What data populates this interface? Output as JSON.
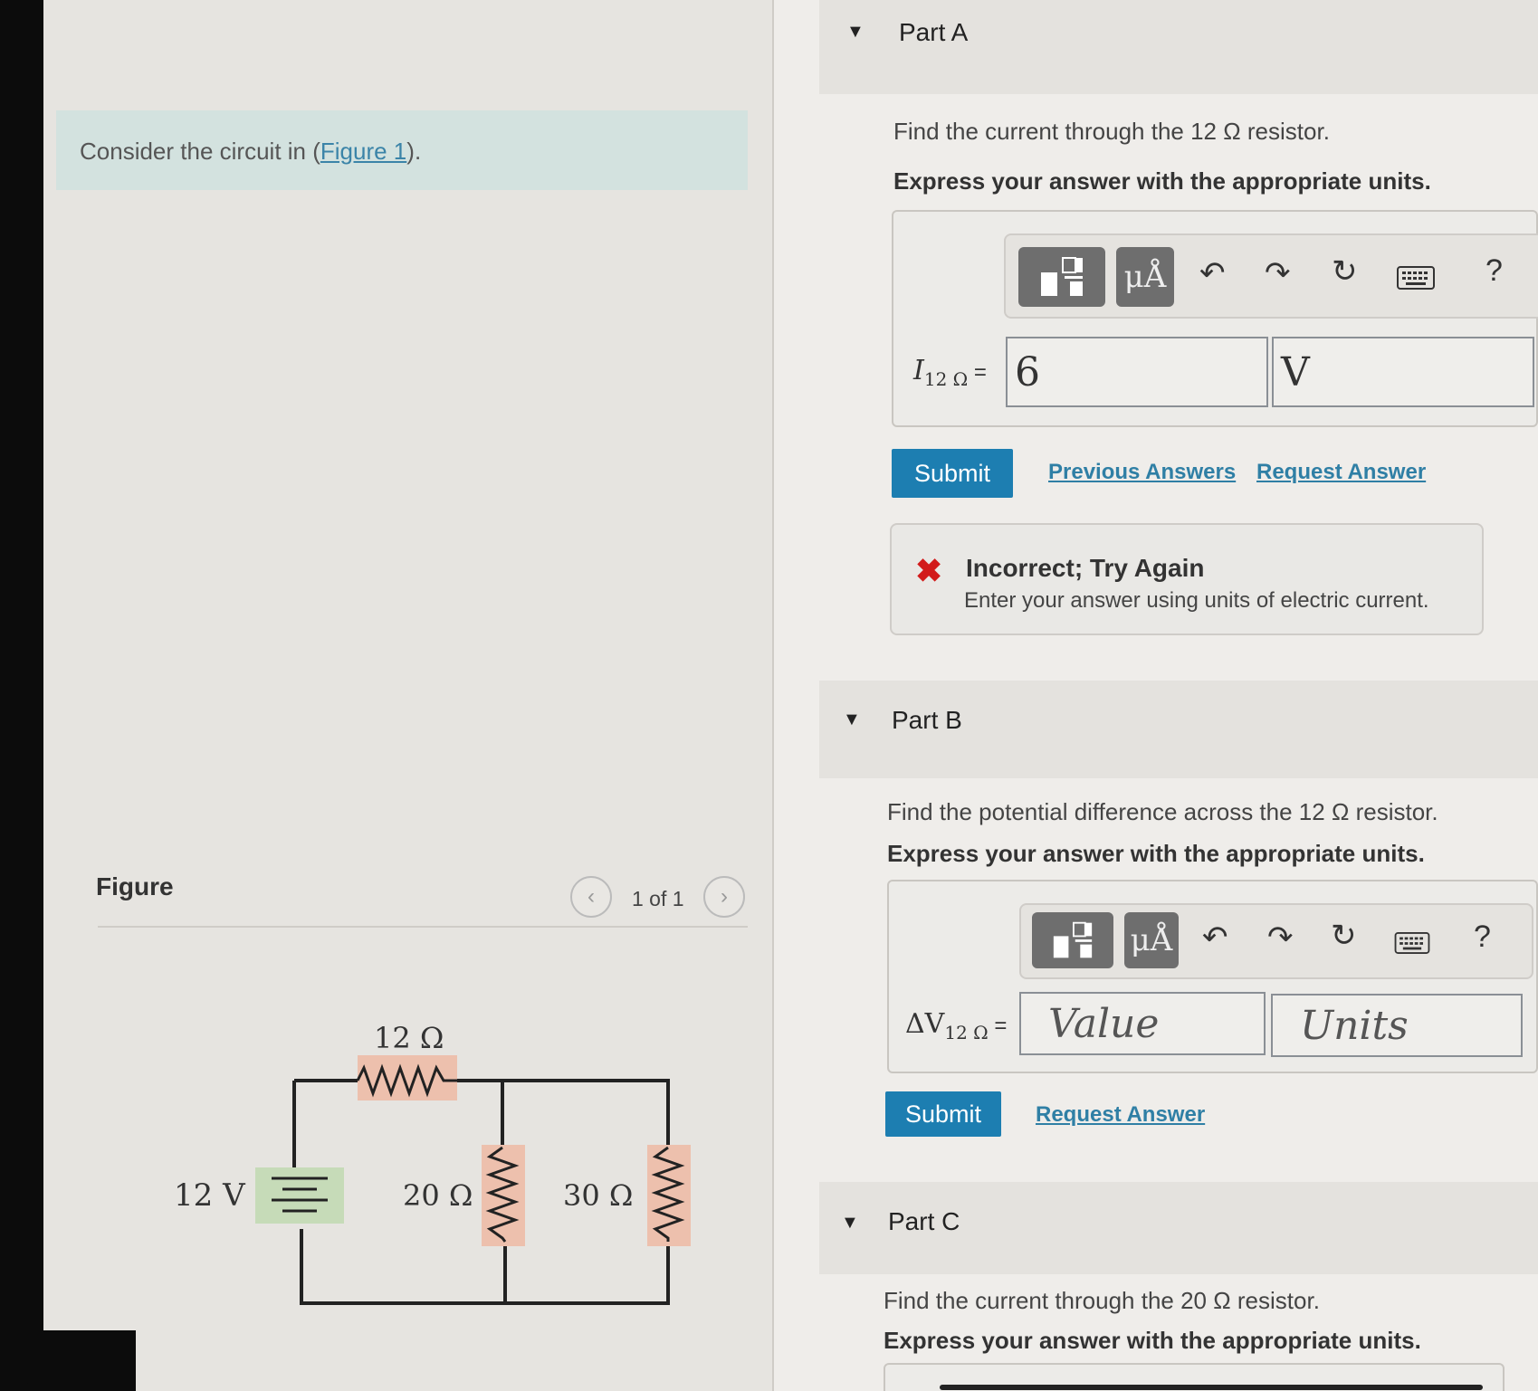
{
  "intro": {
    "text_before": "Consider the circuit in (",
    "link": "Figure 1",
    "text_after": ")."
  },
  "figure": {
    "title": "Figure",
    "pager": "1 of 1",
    "circuit": {
      "battery": "12 V",
      "r1": "12 Ω",
      "r2": "20 Ω",
      "r3": "30 Ω"
    }
  },
  "toolbar": {
    "units_button": "μÅ",
    "help": "?"
  },
  "partA": {
    "title": "Part A",
    "question": "Find the current through the 12 Ω resistor.",
    "instruction": "Express your answer with the appropriate units.",
    "label_main": "I",
    "label_sub": "12 Ω",
    "label_eq": " =",
    "value": "6",
    "units": "V",
    "submit": "Submit",
    "previous_answers": "Previous Answers",
    "request_answer": "Request Answer",
    "feedback_title": "Incorrect; Try Again",
    "feedback_message": "Enter your answer using units of electric current."
  },
  "partB": {
    "title": "Part B",
    "question": "Find the potential difference across the 12 Ω resistor.",
    "instruction": "Express your answer with the appropriate units.",
    "label_main": "ΔV",
    "label_sub": "12 Ω",
    "label_eq": " =",
    "value_placeholder": "Value",
    "units_placeholder": "Units",
    "submit": "Submit",
    "request_answer": "Request Answer"
  },
  "partC": {
    "title": "Part C",
    "question": "Find the current through the 20 Ω resistor.",
    "instruction": "Express your answer with the appropriate units."
  }
}
